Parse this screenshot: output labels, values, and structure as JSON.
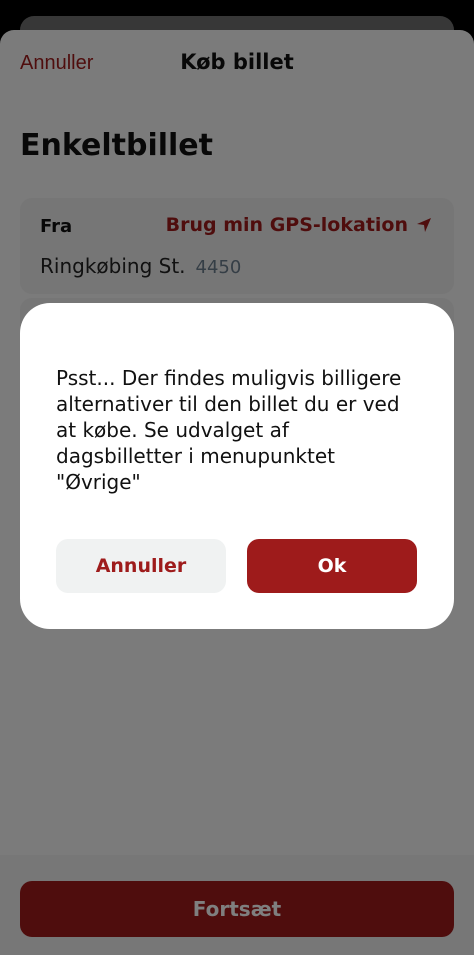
{
  "header": {
    "cancel_label": "Annuller",
    "title": "Køb billet"
  },
  "page": {
    "title": "Enkeltbillet"
  },
  "from": {
    "label": "Fra",
    "gps_label": "Brug min GPS-lokation",
    "gps_icon": "location-arrow-icon",
    "station": "Ringkøbing St.",
    "zip": "4450"
  },
  "footer": {
    "continue_label": "Fortsæt"
  },
  "dialog": {
    "message": "Psst... Der findes muligvis billigere alternativer til den billet du er ved at købe. Se udvalget af dagsbilletter i menupunktet \"Øvrige\"",
    "cancel_label": "Annuller",
    "ok_label": "Ok"
  },
  "colors": {
    "accent": "#9e1b1b",
    "background": "#f6f6f6",
    "card": "#ececec",
    "overlay": "rgba(0,0,0,0.5)"
  }
}
